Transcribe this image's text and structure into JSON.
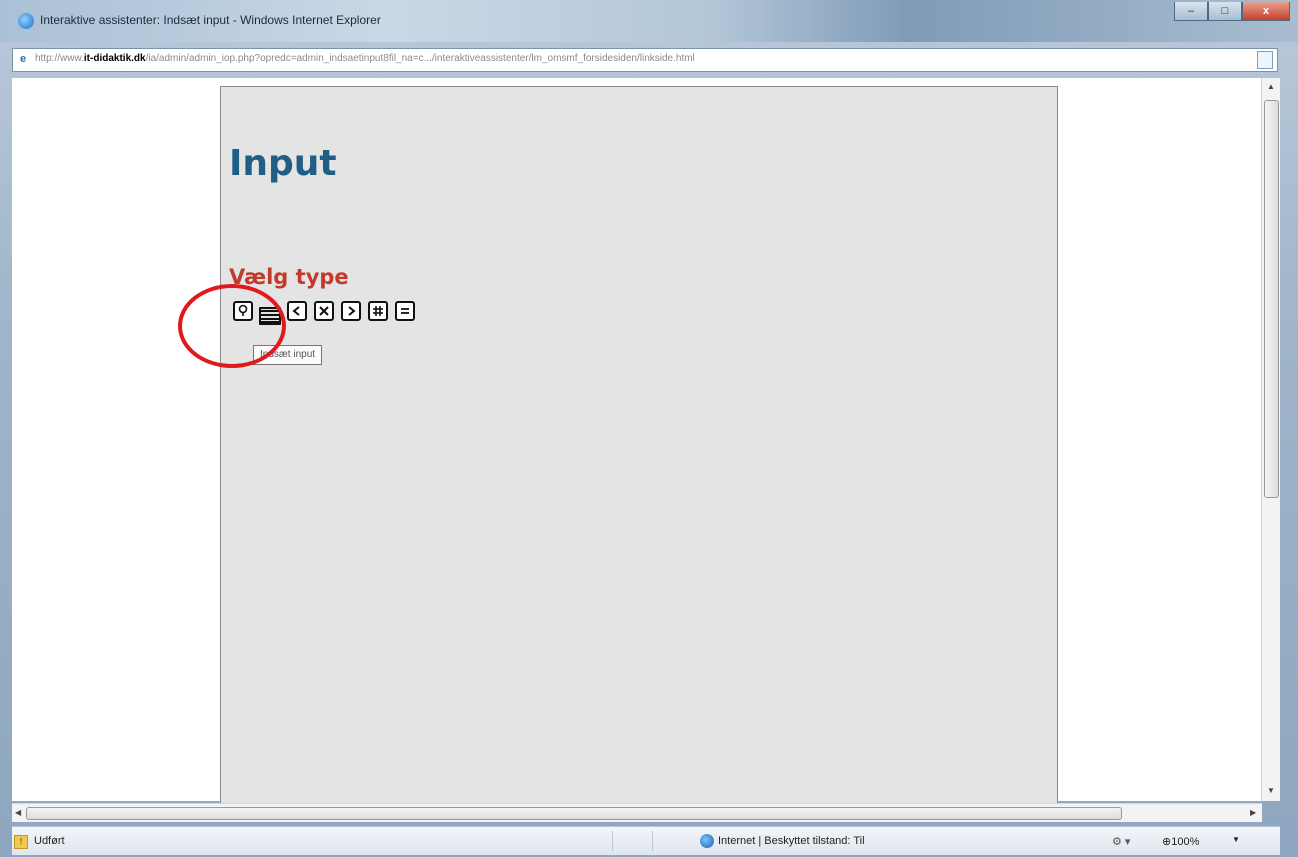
{
  "window": {
    "title": "Interaktive assistenter: Indsæt input - Windows Internet Explorer",
    "controls": {
      "minimize": "–",
      "maximize": "□",
      "close": "x"
    }
  },
  "address": {
    "prefix": "http://www.",
    "domain": "it-didaktik.dk",
    "rest": "/ia/admin/admin_iop.php?opredc=admin_indsaetinput8fil_na=c.../interaktiveassistenter/lm_omsmf_forsidesiden/linkside.html"
  },
  "page": {
    "heading": "Input",
    "subheading": "Vælg type",
    "toolbar_icons": [
      {
        "name": "question-input-icon",
        "glyph": "?"
      },
      {
        "name": "text-input-icon",
        "glyph": ""
      },
      {
        "name": "prev-icon",
        "glyph": "<"
      },
      {
        "name": "delete-icon",
        "glyph": "×"
      },
      {
        "name": "next-icon",
        "glyph": ">"
      },
      {
        "name": "grid-icon",
        "glyph": "#"
      },
      {
        "name": "equals-icon",
        "glyph": "="
      }
    ],
    "tooltip": "Indsæt input"
  },
  "status": {
    "text": "Udført",
    "zone": "Internet | Beskyttet tilstand: Til",
    "zoom": "⊕100%"
  },
  "colors": {
    "heading": "#1f5f86",
    "subheading": "#c13a2b",
    "panel_bg": "#e4e4e4",
    "annotation": "#e0191d"
  }
}
